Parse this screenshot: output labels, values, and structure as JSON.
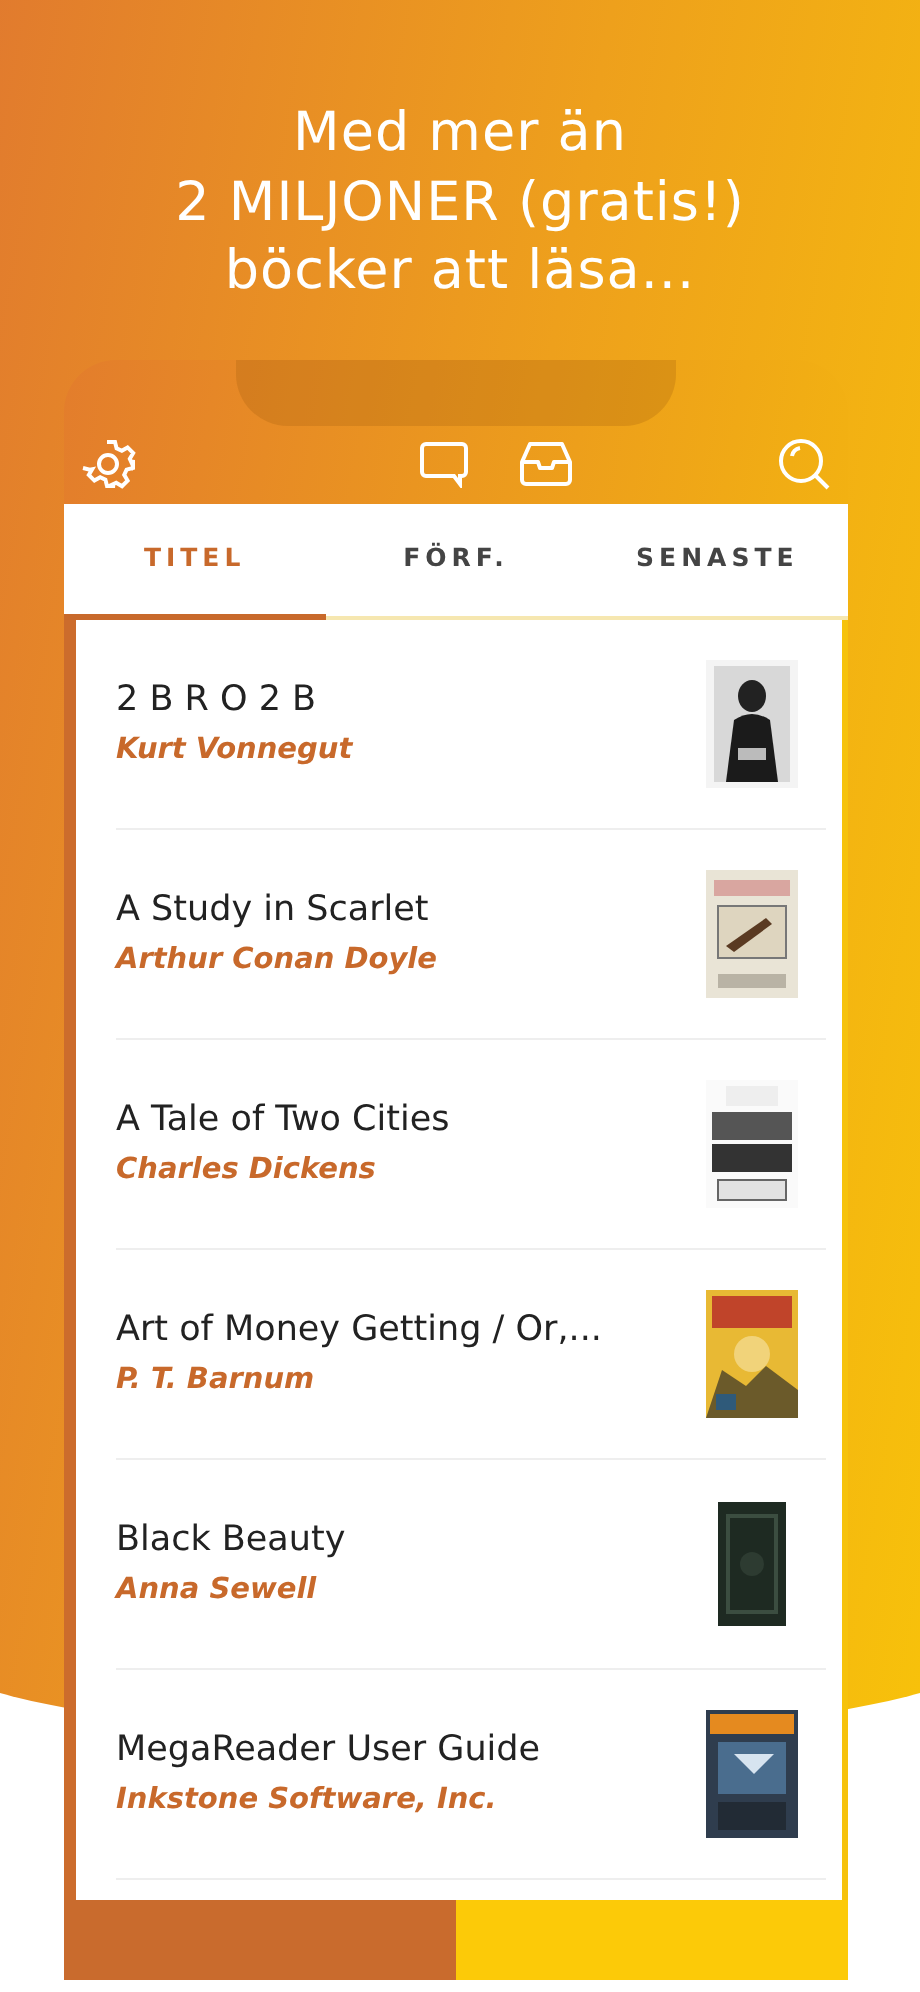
{
  "headline": "Med mer än\n2 MILJONER (gratis!)\nböcker att läsa...",
  "tabs": [
    {
      "label": "TITEL",
      "selected": true
    },
    {
      "label": "FÖRF.",
      "selected": false
    },
    {
      "label": "SENASTE",
      "selected": false
    }
  ],
  "books": [
    {
      "title": "2 B R O 2 B",
      "author": "Kurt Vonnegut"
    },
    {
      "title": "A Study in Scarlet",
      "author": "Arthur Conan Doyle"
    },
    {
      "title": "A Tale of Two Cities",
      "author": "Charles Dickens"
    },
    {
      "title": "Art of Money Getting / Or,...",
      "author": "P. T. Barnum"
    },
    {
      "title": "Black Beauty",
      "author": "Anna Sewell"
    },
    {
      "title": "MegaReader User Guide",
      "author": "Inkstone Software, Inc."
    }
  ]
}
